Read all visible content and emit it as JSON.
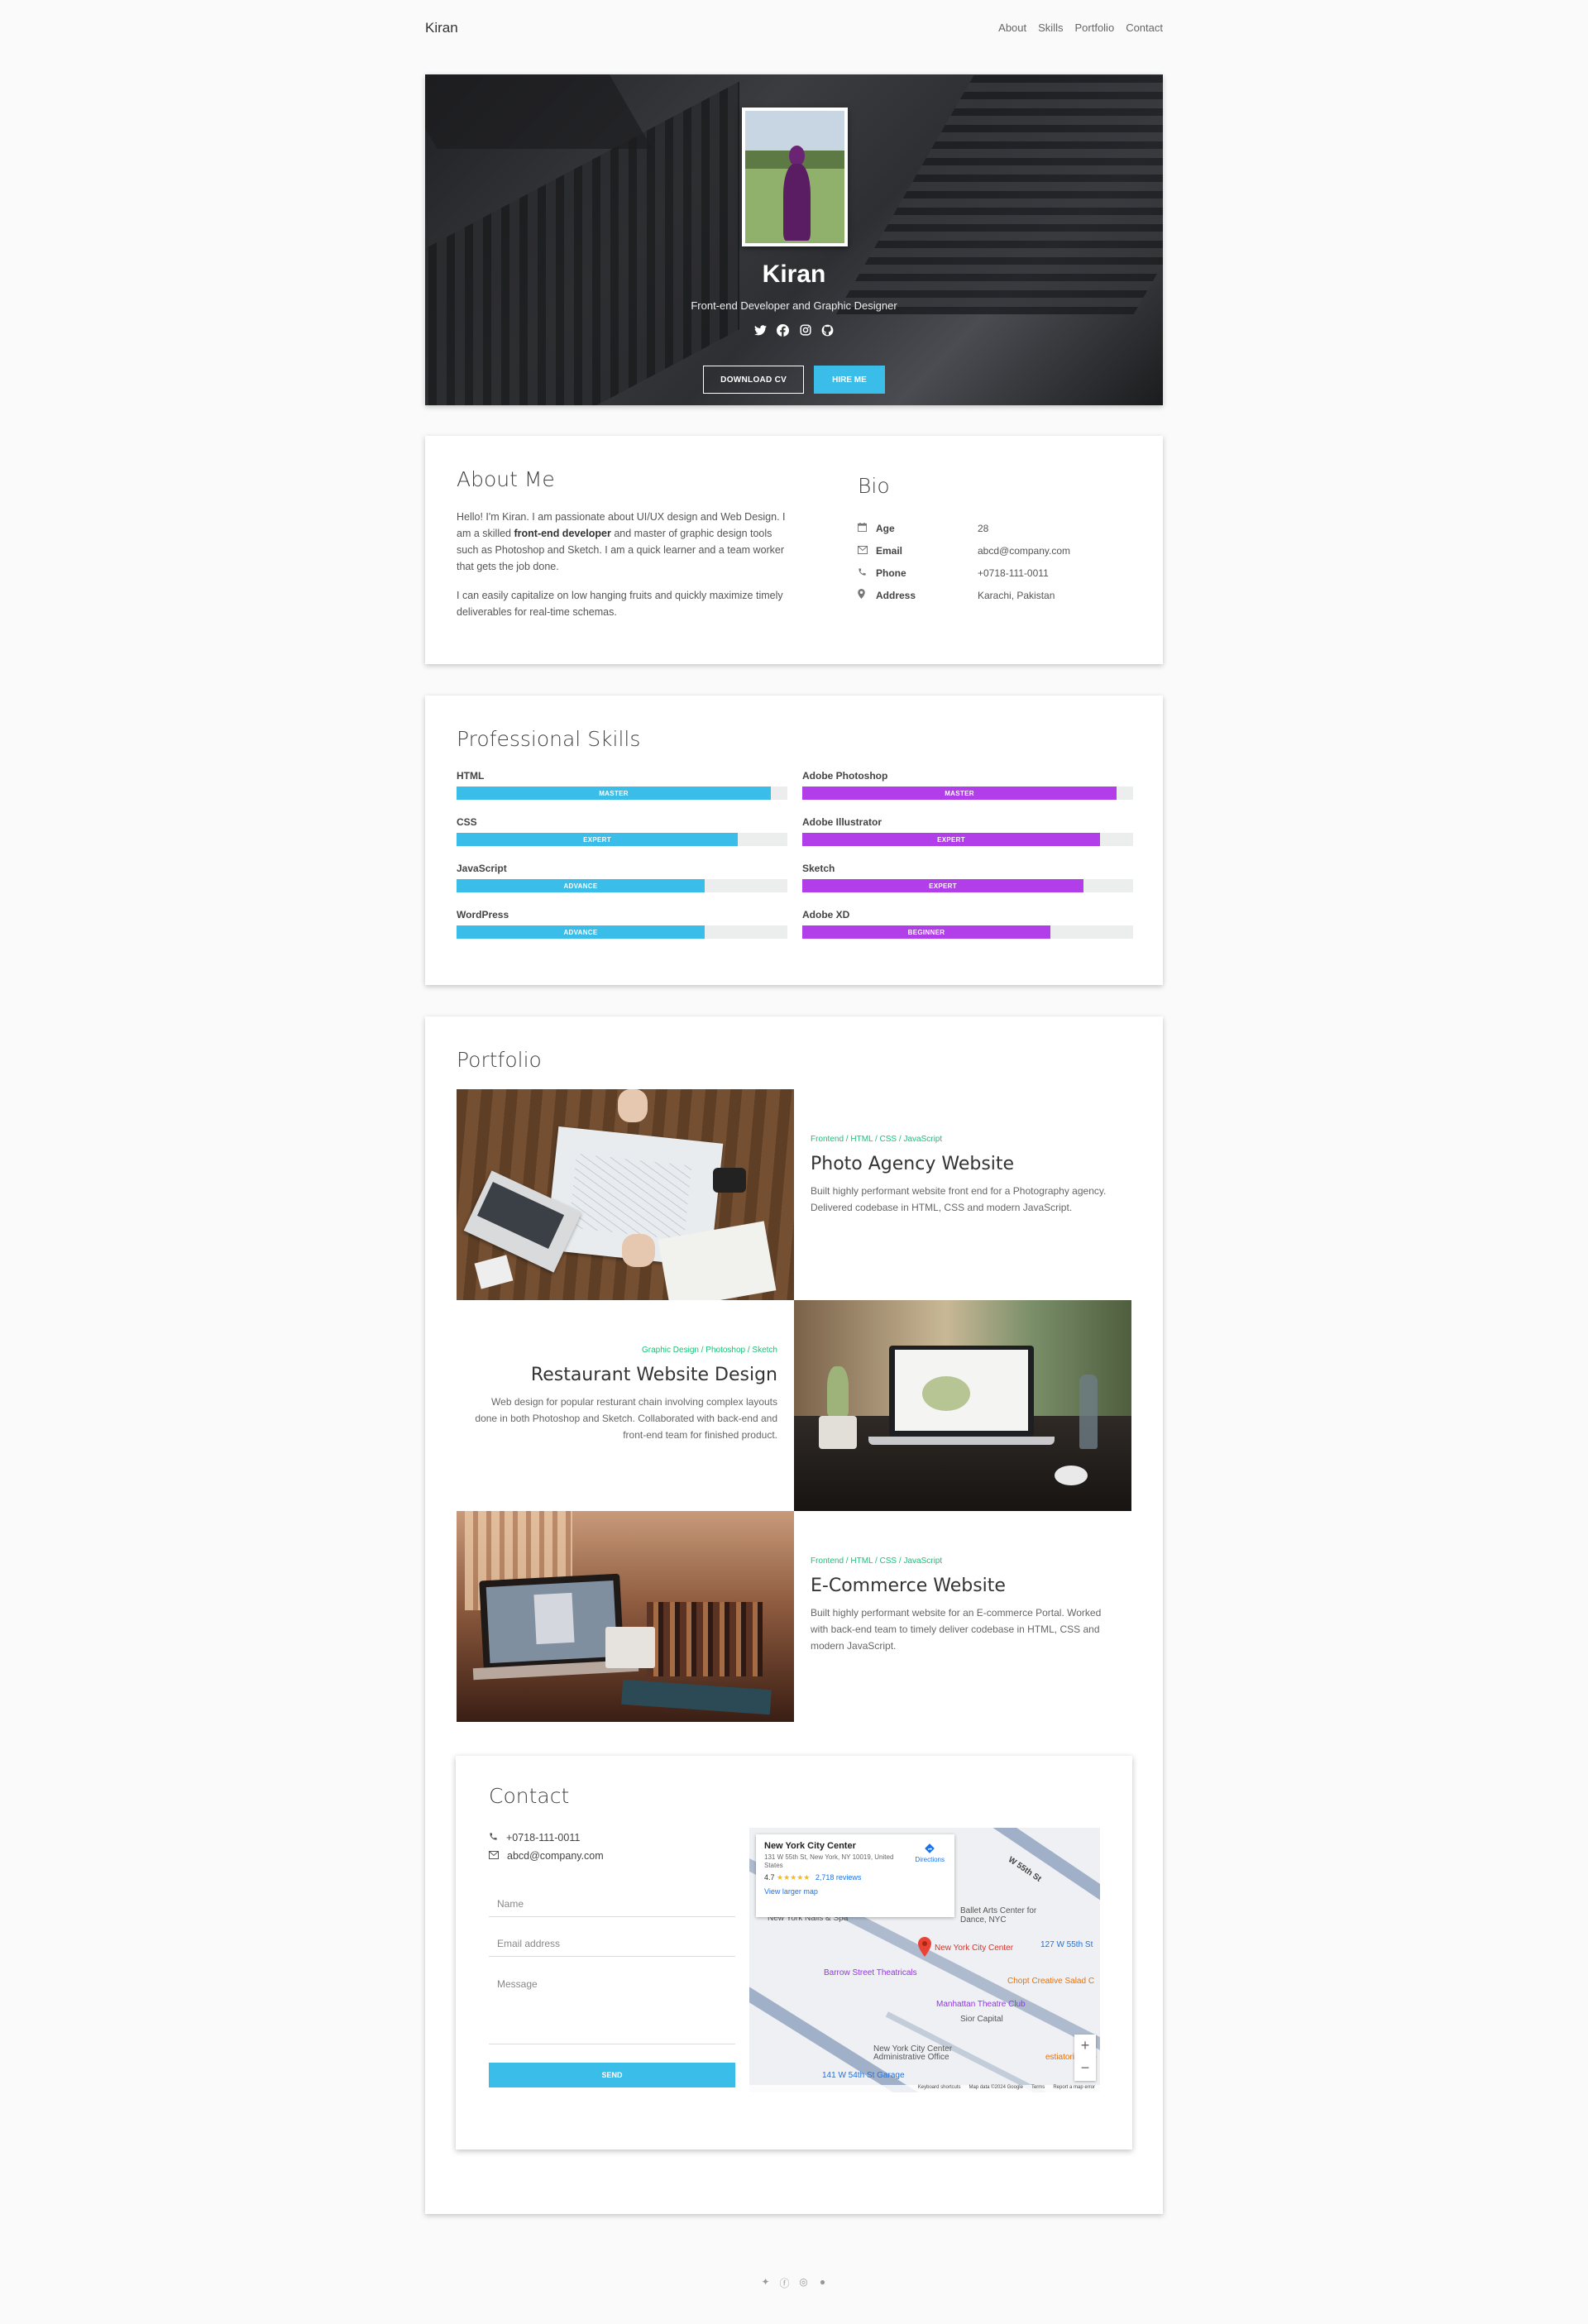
{
  "nav": {
    "brand": "Kiran",
    "links": [
      "About",
      "Skills",
      "Portfolio",
      "Contact"
    ]
  },
  "hero": {
    "name": "Kiran",
    "role": "Front-end Developer and Graphic Designer",
    "socials": [
      "twitter-icon",
      "facebook-icon",
      "instagram-icon",
      "github-icon"
    ],
    "download_label": "DOWNLOAD CV",
    "hire_label": "HIRE ME"
  },
  "about": {
    "title": "About Me",
    "p1_a": "Hello! I'm Kiran. I am passionate about UI/UX design and Web Design. I am a skilled ",
    "p1_bold": "front-end developer",
    "p1_b": " and master of graphic design tools such as Photoshop and Sketch. I am a quick learner and a team worker that gets the job done.",
    "p2": "I can easily capitalize on low hanging fruits and quickly maximize timely deliverables for real-time schemas."
  },
  "bio": {
    "title": "Bio",
    "rows": [
      {
        "icon": "calendar-icon",
        "label": "Age",
        "value": "28"
      },
      {
        "icon": "envelope-icon",
        "label": "Email",
        "value": "abcd@company.com"
      },
      {
        "icon": "phone-icon",
        "label": "Phone",
        "value": "+0718-111-0011"
      },
      {
        "icon": "map-marker-icon",
        "label": "Address",
        "value": "Karachi, Pakistan"
      }
    ]
  },
  "skills": {
    "title": "Professional Skills",
    "left": [
      {
        "name": "HTML",
        "level": "MASTER",
        "percent": 95
      },
      {
        "name": "CSS",
        "level": "EXPERT",
        "percent": 85
      },
      {
        "name": "JavaScript",
        "level": "ADVANCE",
        "percent": 75
      },
      {
        "name": "WordPress",
        "level": "ADVANCE",
        "percent": 75
      }
    ],
    "right": [
      {
        "name": "Adobe Photoshop",
        "level": "MASTER",
        "percent": 95
      },
      {
        "name": "Adobe Illustrator",
        "level": "EXPERT",
        "percent": 90
      },
      {
        "name": "Sketch",
        "level": "EXPERT",
        "percent": 85
      },
      {
        "name": "Adobe XD",
        "level": "BEGINNER",
        "percent": 75
      }
    ],
    "colors": {
      "left": "#3bbdea",
      "right": "#b13ee9"
    }
  },
  "portfolio": {
    "title": "Portfolio",
    "items": [
      {
        "tags": "Frontend / HTML / CSS / JavaScript",
        "title": "Photo Agency Website",
        "desc": "Built highly performant website front end for a Photography agency. Delivered codebase in HTML, CSS and modern JavaScript."
      },
      {
        "tags": "Graphic Design / Photoshop / Sketch",
        "title": "Restaurant Website Design",
        "desc": "Web design for popular resturant chain involving complex layouts done in both Photoshop and Sketch. Collaborated with back-end and front-end team for finished product."
      },
      {
        "tags": "Frontend / HTML / CSS / JavaScript",
        "title": "E-Commerce Website",
        "desc": "Built highly performant website for an E-commerce Portal. Worked with back-end team to timely deliver codebase in HTML, CSS and modern JavaScript."
      }
    ]
  },
  "contact": {
    "title": "Contact",
    "phone": "+0718-111-0011",
    "email": "abcd@company.com",
    "name_placeholder": "Name",
    "email_placeholder": "Email address",
    "message_placeholder": "Message",
    "send_label": "SEND"
  },
  "map": {
    "place": "New York City Center",
    "address": "131 W 55th St, New York, NY 10019, United States",
    "rating": "4.7",
    "stars": "★★★★★",
    "reviews": "2,718 reviews",
    "directions": "Directions",
    "larger": "View larger map",
    "labels": {
      "nails": "New York Nails & Spa",
      "ballet": "Ballet Arts Center for Dance, NYC",
      "pin": "New York City Center",
      "addr55": "127 W 55th St",
      "barrow": "Barrow Street Theatricals",
      "chopt": "Chopt Creative Salad C",
      "manhattan": "Manhattan Theatre Club",
      "sior": "Sior Capital",
      "nycc_admin": "New York City Center Administrative Office",
      "garage": "141 W 54th St Garage",
      "street": "W 55th St",
      "esm": "estiatorio Milo",
      "keyboard": "Keyboard shortcuts",
      "mapdata": "Map data ©2024 Google",
      "terms": "Terms",
      "report": "Report a map error"
    }
  },
  "footer": {
    "socials": [
      "twitter-icon",
      "facebook-icon",
      "instagram-icon",
      "github-icon"
    ]
  }
}
